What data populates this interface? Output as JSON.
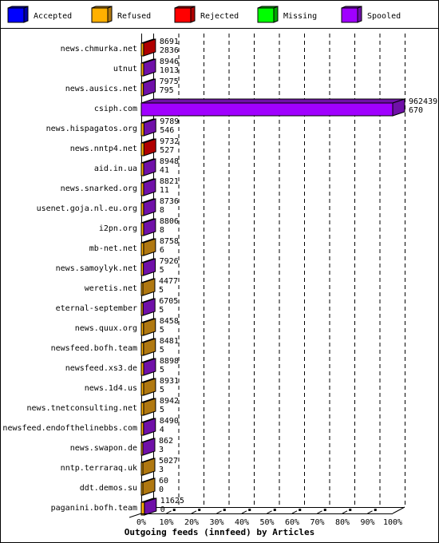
{
  "chart_data": {
    "type": "bar",
    "orientation": "horizontal",
    "style": "3d-stacked",
    "xlabel": "Outgoing feeds (innfeed) by Articles",
    "x_ticks": [
      "0%",
      "10%",
      "20%",
      "30%",
      "40%",
      "50%",
      "60%",
      "70%",
      "80%",
      "90%",
      "100%"
    ],
    "xlim": [
      0,
      100
    ],
    "grid": true,
    "legend_position": "top",
    "legend": [
      {
        "name": "Accepted",
        "color": "#0000ff",
        "side": "#0000a8"
      },
      {
        "name": "Refused",
        "color": "#ffb000",
        "side": "#b07810"
      },
      {
        "name": "Rejected",
        "color": "#ff0000",
        "side": "#b00000"
      },
      {
        "name": "Missing",
        "color": "#00ff00",
        "side": "#00a800"
      },
      {
        "name": "Spooled",
        "color": "#a000ff",
        "side": "#7010a8"
      }
    ],
    "categories": [
      "news.chmurka.net",
      "utnut",
      "news.ausics.net",
      "csiph.com",
      "news.hispagatos.org",
      "news.nntp4.net",
      "aid.in.ua",
      "news.snarked.org",
      "usenet.goja.nl.eu.org",
      "i2pn.org",
      "mb-net.net",
      "news.samoylyk.net",
      "weretis.net",
      "eternal-september",
      "news.quux.org",
      "newsfeed.bofh.team",
      "newsfeed.xs3.de",
      "news.1d4.us",
      "news.tnetconsulting.net",
      "newsfeed.endofthelinebbs.com",
      "news.swapon.de",
      "nntp.terraraq.uk",
      "ddt.demos.su",
      "paganini.bofh.team"
    ],
    "values_top": [
      8691,
      8946,
      7975,
      962439,
      9789,
      9732,
      8948,
      8821,
      8736,
      8806,
      8758,
      7926,
      4477,
      6705,
      8458,
      8481,
      8898,
      8931,
      8942,
      8490,
      862,
      5027,
      60,
      11625
    ],
    "values_bottom": [
      2836,
      1013,
      795,
      670,
      546,
      527,
      41,
      11,
      8,
      8,
      6,
      5,
      5,
      5,
      5,
      5,
      5,
      5,
      5,
      4,
      3,
      3,
      0,
      0
    ],
    "dominant_series": [
      "Rejected",
      "Spooled",
      "Spooled",
      "Spooled",
      "Spooled",
      "Rejected",
      "Spooled",
      "Spooled",
      "Spooled",
      "Spooled",
      "Refused",
      "Spooled",
      "Refused",
      "Spooled",
      "Refused",
      "Refused",
      "Spooled",
      "Refused",
      "Refused",
      "Spooled",
      "Spooled",
      "Refused",
      "Refused",
      "Spooled"
    ]
  }
}
